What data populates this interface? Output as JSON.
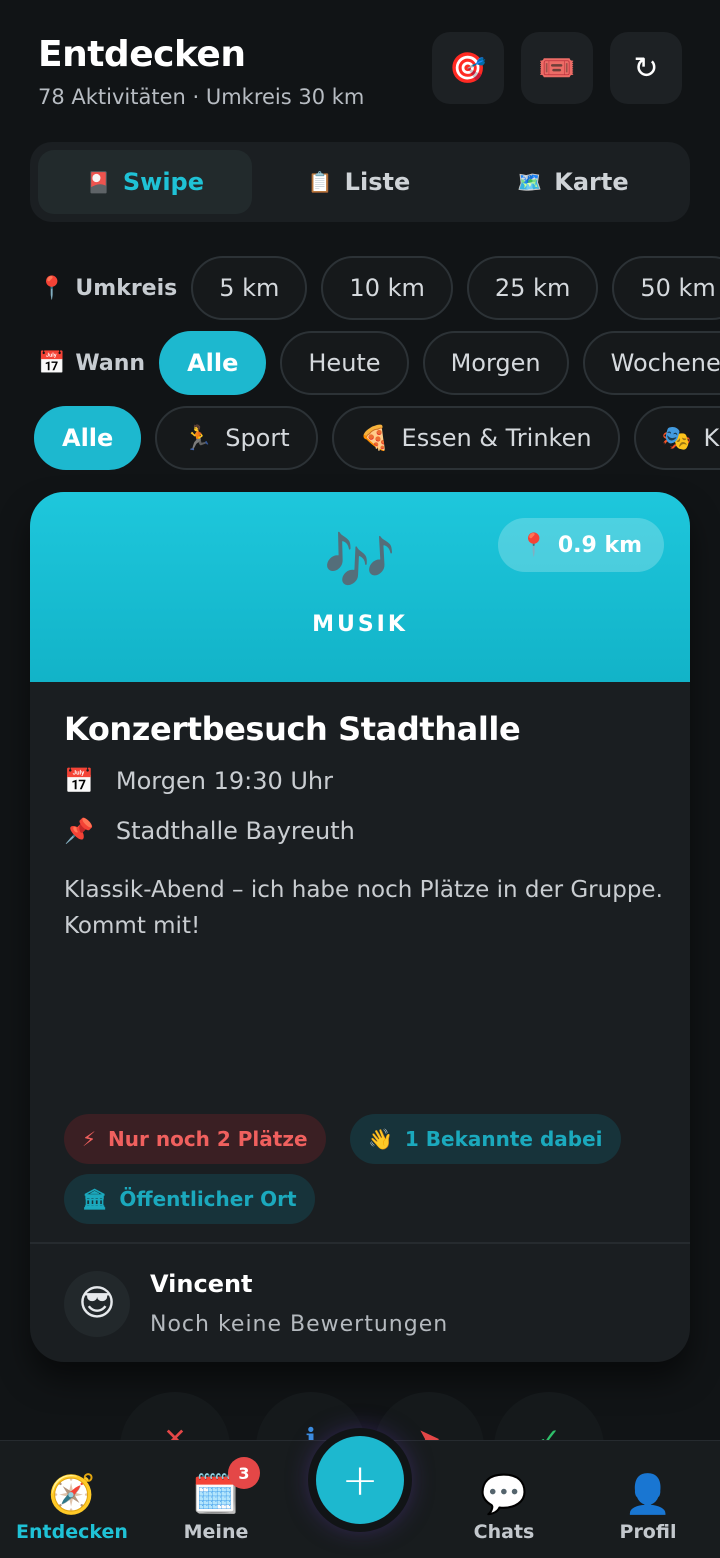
{
  "header": {
    "title": "Entdecken",
    "subtitle": "78 Aktivitäten · Umkreis 30 km",
    "buttons": [
      {
        "icon": "target-icon",
        "glyph": "🎯"
      },
      {
        "icon": "ticket-icon",
        "glyph": "🎟️"
      },
      {
        "icon": "refresh-icon",
        "glyph": "↻"
      }
    ]
  },
  "view_tabs": [
    {
      "label": "Swipe",
      "icon": "🎴",
      "active": true
    },
    {
      "label": "Liste",
      "icon": "📋",
      "active": false
    },
    {
      "label": "Karte",
      "icon": "🗺️",
      "active": false
    }
  ],
  "radius_filter": {
    "label": "Umkreis",
    "icon": "📍",
    "options": [
      "5 km",
      "10 km",
      "25 km",
      "50 km"
    ]
  },
  "when_filter": {
    "label": "Wann",
    "icon": "📅",
    "options": [
      "Alle",
      "Heute",
      "Morgen",
      "Wochenende"
    ],
    "selected": "Alle"
  },
  "category_filter": {
    "options": [
      {
        "label": "Alle",
        "icon": ""
      },
      {
        "label": "Sport",
        "icon": "🏃"
      },
      {
        "label": "Essen & Trinken",
        "icon": "🍕"
      },
      {
        "label": "Kultur",
        "icon": "🎭"
      }
    ],
    "selected": "Alle"
  },
  "card": {
    "category": "MUSIK",
    "category_emoji": "🎶",
    "distance": "0.9 km",
    "distance_icon": "📍",
    "title": "Konzertbesuch Stadthalle",
    "date": "Morgen 19:30 Uhr",
    "date_icon": "📅",
    "location": "Stadthalle Bayreuth",
    "location_icon": "📌",
    "description": "Klassik-Abend – ich habe noch Plätze in der Gruppe. Kommt mit!",
    "badges": {
      "spots": {
        "icon": "⚡",
        "text": "Nur noch 2 Plätze",
        "color": "#f0605e"
      },
      "friends": {
        "icon": "👋",
        "text": "1 Bekannte dabei",
        "color": "#1ba9bd"
      },
      "public": {
        "icon": "🏛",
        "text": "Öffentlicher Ort",
        "color": "#1ba9bd"
      }
    },
    "host": {
      "name": "Vincent",
      "rating": "Noch keine Bewertungen",
      "avatar": "😎"
    }
  },
  "tabbar": {
    "items": [
      {
        "label": "Entdecken",
        "icon": "🧭",
        "active": true
      },
      {
        "label": "Meine",
        "icon": "🗓️",
        "badge": "3"
      },
      {
        "label": "Chats",
        "icon": "💬"
      },
      {
        "label": "Profil",
        "icon": "👤"
      }
    ],
    "fab": "+"
  },
  "colors": {
    "accent": "#1db8cf",
    "background": "#111416",
    "card": "#1a1e21",
    "danger": "#e44747"
  }
}
